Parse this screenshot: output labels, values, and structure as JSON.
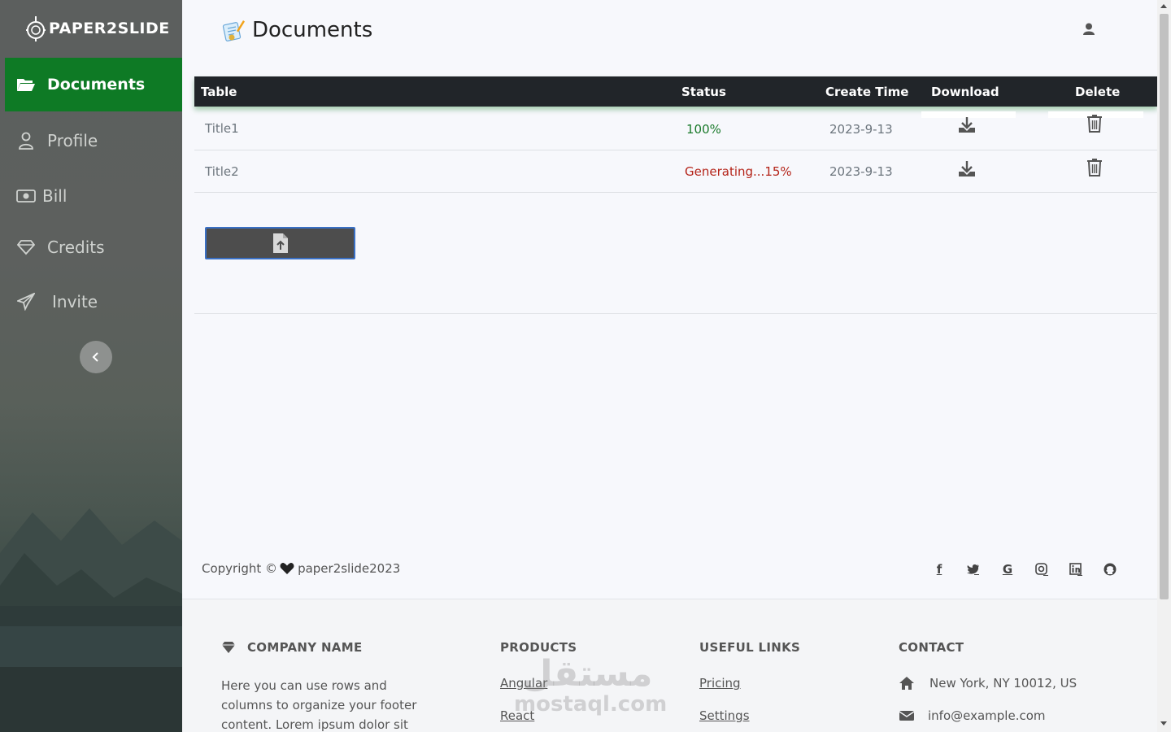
{
  "brand": {
    "name": "PAPER2SLIDE"
  },
  "sidebar": {
    "items": [
      {
        "label": "Documents",
        "icon": "folder-open-icon",
        "active": true
      },
      {
        "label": "Profile",
        "icon": "user-icon"
      },
      {
        "label": "Bill",
        "icon": "money-icon"
      },
      {
        "label": "Credits",
        "icon": "diamond-icon"
      },
      {
        "label": "Invite",
        "icon": "paper-plane-icon"
      }
    ],
    "accent": "#0e7a25"
  },
  "header": {
    "title": "Documents"
  },
  "table": {
    "columns": [
      "Table",
      "Status",
      "Create Time",
      "Download",
      "Delete"
    ],
    "rows": [
      {
        "title": "Title1",
        "status": "100%",
        "create_time": "2023-9-13"
      },
      {
        "title": "Title2",
        "status": "Generating...15%",
        "create_time": "2023-9-13"
      }
    ],
    "status_colors": {
      "done": "#1a7a2b",
      "generating": "#b42318"
    }
  },
  "copyright": {
    "prefix": "Copyright ©",
    "name": "paper2slide2023"
  },
  "socials": [
    "facebook-icon",
    "twitter-icon",
    "google-icon",
    "instagram-icon",
    "linkedin-icon",
    "github-icon"
  ],
  "footer": {
    "company": {
      "heading": "COMPANY NAME",
      "text": "Here you can use rows and columns to organize your footer content. Lorem ipsum dolor sit amet,"
    },
    "products": {
      "heading": "PRODUCTS",
      "links": [
        "Angular",
        "React"
      ]
    },
    "useful": {
      "heading": "USEFUL LINKS",
      "links": [
        "Pricing",
        "Settings"
      ]
    },
    "contact": {
      "heading": "CONTACT",
      "address": "New York, NY 10012, US",
      "email": "info@example.com"
    }
  },
  "watermark": {
    "arabic": "مستقل",
    "latin": "mostaql.com"
  }
}
